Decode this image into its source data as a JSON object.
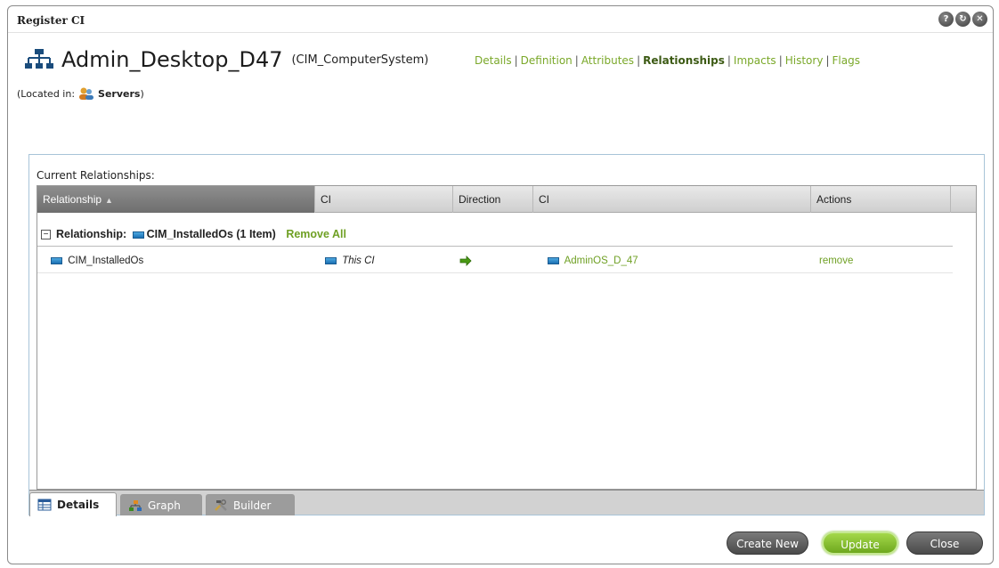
{
  "window": {
    "title": "Register CI"
  },
  "window_buttons": [
    {
      "icon": "help-icon",
      "glyph": "?"
    },
    {
      "icon": "refresh-icon",
      "glyph": "↻"
    },
    {
      "icon": "close-icon",
      "glyph": "✕"
    }
  ],
  "ci": {
    "name": "Admin_Desktop_D47",
    "type": "(CIM_ComputerSystem)"
  },
  "located": {
    "prefix": "(Located in:",
    "folder": "Servers",
    "suffix": ")"
  },
  "nav": [
    {
      "label": "Details",
      "active": false
    },
    {
      "label": "Definition",
      "active": false
    },
    {
      "label": "Attributes",
      "active": false
    },
    {
      "label": "Relationships",
      "active": true
    },
    {
      "label": "Impacts",
      "active": false
    },
    {
      "label": "History",
      "active": false
    },
    {
      "label": "Flags",
      "active": false
    }
  ],
  "panel": {
    "label": "Current Relationships:"
  },
  "grid": {
    "columns": [
      "Relationship",
      "CI",
      "Direction",
      "CI",
      "Actions"
    ],
    "group": {
      "prefix": "Relationship:",
      "name": "CIM_InstalledOs (1 Item)",
      "remove_all": "Remove All"
    },
    "rows": [
      {
        "relationship": "CIM_InstalledOs",
        "ci_from": "This CI",
        "direction": "→",
        "ci_to": "AdminOS_D_47",
        "action": "remove"
      }
    ]
  },
  "tabs": [
    {
      "label": "Details",
      "icon": "table-icon",
      "active": true
    },
    {
      "label": "Graph",
      "icon": "graph-icon",
      "active": false
    },
    {
      "label": "Builder",
      "icon": "tools-icon",
      "active": false
    }
  ],
  "buttons": {
    "create_new": "Create New",
    "update": "Update",
    "close": "Close"
  },
  "colors": {
    "link_green": "#7aa829",
    "active_nav": "#3c5a14",
    "panel_border": "#a8c4d8"
  }
}
